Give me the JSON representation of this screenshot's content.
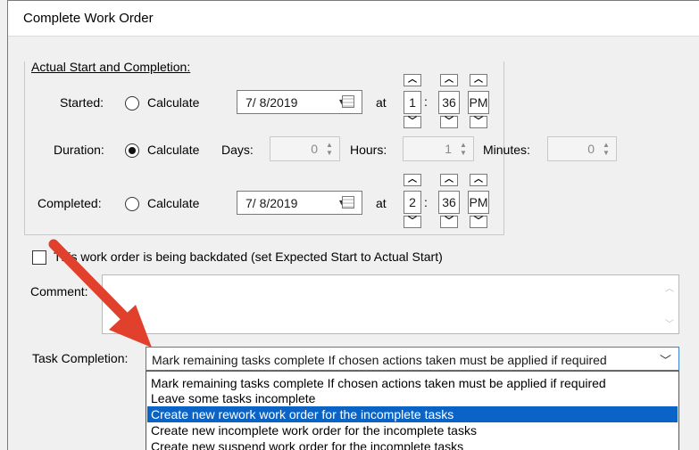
{
  "window": {
    "title": "Complete Work Order"
  },
  "group": {
    "label": "Actual Start and Completion:"
  },
  "started": {
    "label": "Started:",
    "radio_label": "Calculate",
    "date": "7/ 8/2019",
    "at": "at",
    "hour": "1",
    "sep": ":",
    "minute": "36",
    "ampm": "PM"
  },
  "duration": {
    "label": "Duration:",
    "radio_label": "Calculate",
    "days_label": "Days:",
    "days": "0",
    "hours_label": "Hours:",
    "hours": "1",
    "minutes_label": "Minutes:",
    "minutes": "0"
  },
  "completed": {
    "label": "Completed:",
    "radio_label": "Calculate",
    "date": "7/ 8/2019",
    "at": "at",
    "hour": "2",
    "sep": ":",
    "minute": "36",
    "ampm": "PM"
  },
  "backdated": {
    "label": "This work order is being backdated (set Expected Start to Actual Start)"
  },
  "comment": {
    "label": "Comment:",
    "value": ""
  },
  "task_completion": {
    "label": "Task Completion:",
    "selected": "Mark remaining tasks complete If chosen actions taken must be applied if required",
    "options": [
      "Mark remaining tasks complete If chosen actions taken must be applied if required",
      "Leave some tasks incomplete",
      "Create new rework work order for the incomplete tasks",
      "Create new incomplete work order for the incomplete tasks",
      "Create new suspend work order for the incomplete tasks"
    ],
    "highlighted_index": 2
  },
  "colors": {
    "highlight": "#0a64c8",
    "annotation_arrow": "#e0402c"
  }
}
